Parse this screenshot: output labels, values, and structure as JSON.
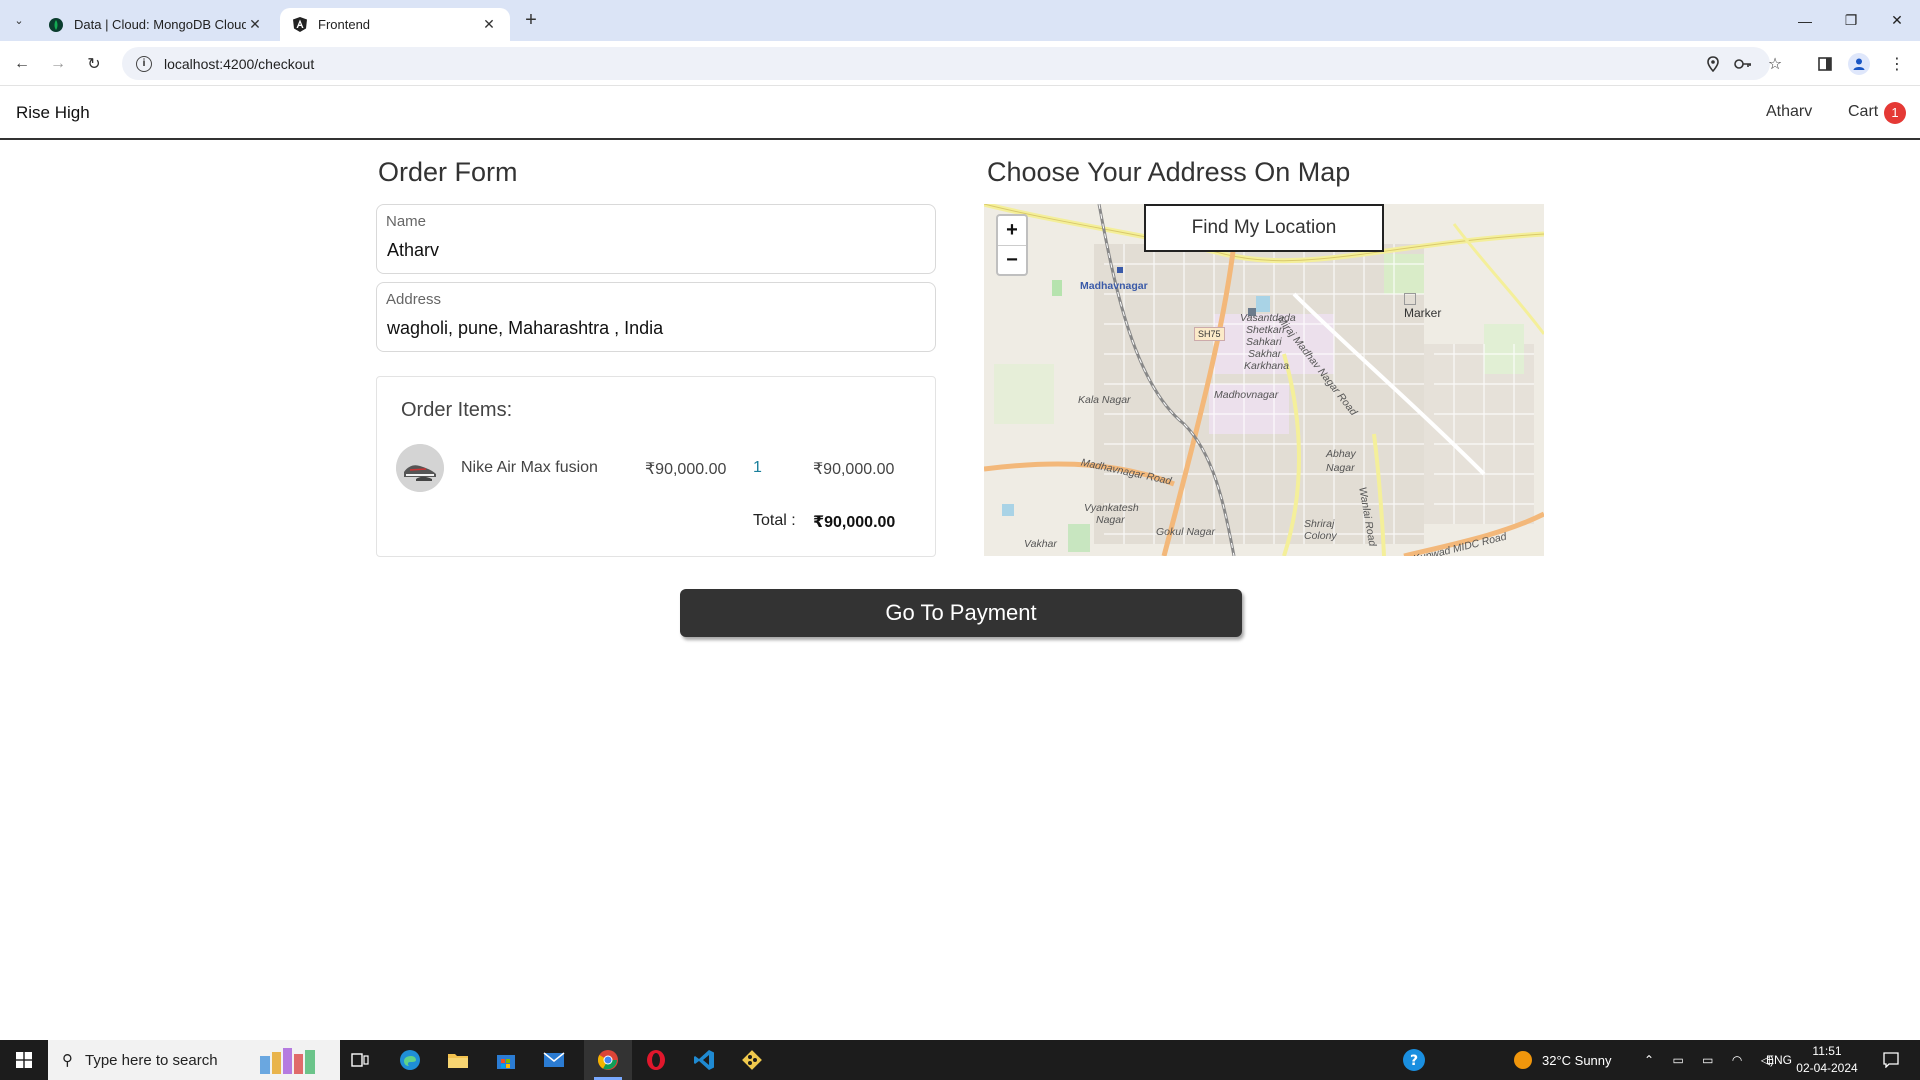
{
  "browser": {
    "tabs": [
      {
        "title": "Data | Cloud: MongoDB Cloud",
        "icon": "mongodb-leaf-icon",
        "active": false
      },
      {
        "title": "Frontend",
        "icon": "angular-icon",
        "active": true
      }
    ],
    "url": "localhost:4200/checkout"
  },
  "nav": {
    "brand": "Rise High",
    "user": "Atharv",
    "cart_label": "Cart",
    "cart_count": "1"
  },
  "order_form": {
    "title": "Order Form",
    "name": {
      "label": "Name",
      "value": "Atharv"
    },
    "address": {
      "label": "Address",
      "value": "wagholi, pune, Maharashtra , India"
    }
  },
  "order_items": {
    "title": "Order Items:",
    "items": [
      {
        "name": "Nike Air Max fusion",
        "price": "₹90,000.00",
        "quantity": "1",
        "subtotal": "₹90,000.00"
      }
    ],
    "total_label": "Total :",
    "total_value": "₹90,000.00"
  },
  "map": {
    "title": "Choose Your Address On Map",
    "zoom_in": "+",
    "zoom_out": "−",
    "find_location": "Find My Location",
    "marker_alt": "Marker",
    "labels": {
      "madhavnagar_top": "Madhavnagar",
      "sh75": "SH75",
      "vasantdada": "Vasantdada",
      "shetkari": "Shetkari",
      "sahkari": "Sahkari",
      "sakhar": "Sakhar",
      "karkhana": "Karkhana",
      "madhovnagar": "Madhovnagar",
      "kala_nagar": "Kala Nagar",
      "abhay": "Abhay",
      "abhay_nagar": "Nagar",
      "madhavnagar_road": "Madhavnagar Road",
      "vyankatesh": "Vyankatesh",
      "vyankatesh_nagar": "Nagar",
      "gokul_nagar": "Gokul Nagar",
      "shriraj": "Shriraj",
      "colony": "Colony",
      "mira_road": "Miraj Madhav Nagar Road",
      "kupwad": "Kupwad MIDC Road",
      "wanlai": "Wanlai Road",
      "vakhar": "Vakhar"
    }
  },
  "checkout": {
    "pay_button": "Go To Payment"
  },
  "taskbar": {
    "search_placeholder": "Type here to search",
    "weather": "32°C  Sunny",
    "lang": "ENG",
    "time": "11:51",
    "date": "02-04-2024"
  }
}
